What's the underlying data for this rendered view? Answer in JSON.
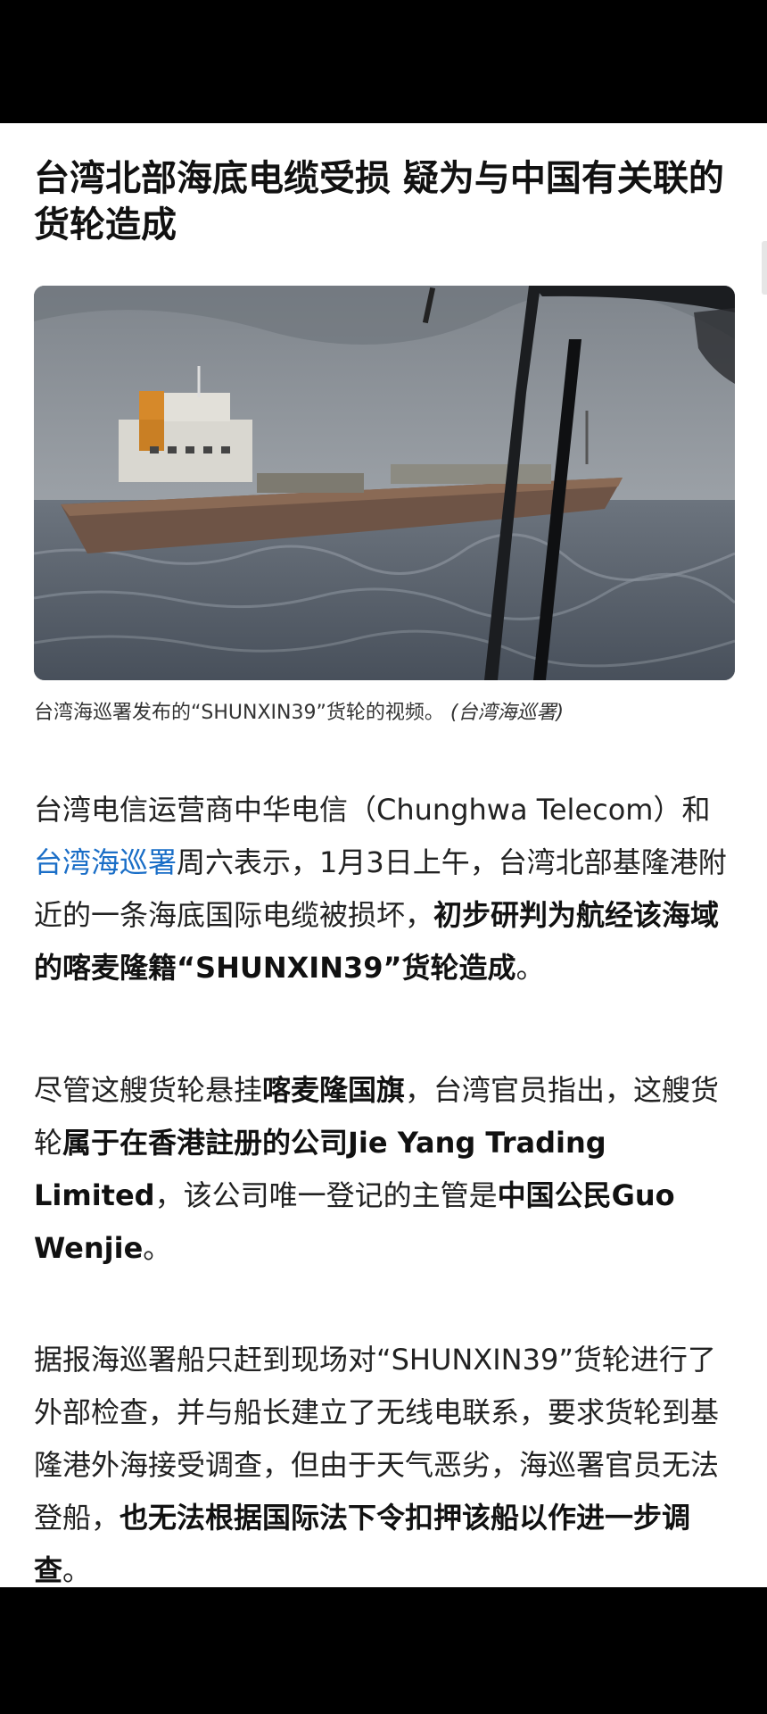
{
  "article": {
    "headline": "台湾北部海底电缆受损 疑为与中国有关联的货轮造成",
    "image": {
      "icon": "cargo-ship-photo",
      "colors": {
        "sky": "#9aa0a6",
        "sea": "#5b6470",
        "hull": "#6e5446"
      }
    },
    "caption": {
      "text": "台湾海巡署发布的“SHUNXIN39”货轮的视频。",
      "credit": "(台湾海巡署)"
    },
    "paragraphs": {
      "p1": {
        "s1": "台湾电信运营商中华电信（Chunghwa Telecom）和",
        "link": "台湾海巡署",
        "s2": "周六表示，1月3日上午，台湾北部基隆港附近的一条海底国际电缆被损坏，",
        "bold": "初步研判为航经该海域的喀麦隆籍“SHUNXIN39”货轮造成",
        "s3": "。"
      },
      "p2": {
        "s1": "尽管这艘货轮悬挂",
        "b1": "喀麦隆国旗",
        "s2": "，台湾官员指出，这艘货轮",
        "b2": "属于在香港註册的公司Jie Yang Trading Limited",
        "s3": "，该公司唯一登记的主管是",
        "b3": "中国公民Guo Wenjie",
        "s4": "。"
      },
      "p3": {
        "s1": "据报海巡署船只赶到现场对“SHUNXIN39”货轮进行了外部检查，并与船长建立了无线电联系，要求货轮到基隆港外海接受调查，但由于天气恶劣，海巡署官员无法登船，",
        "bold": "也无法根据国际法下令扣押该船以作进一步调查",
        "s2": "。"
      }
    }
  }
}
